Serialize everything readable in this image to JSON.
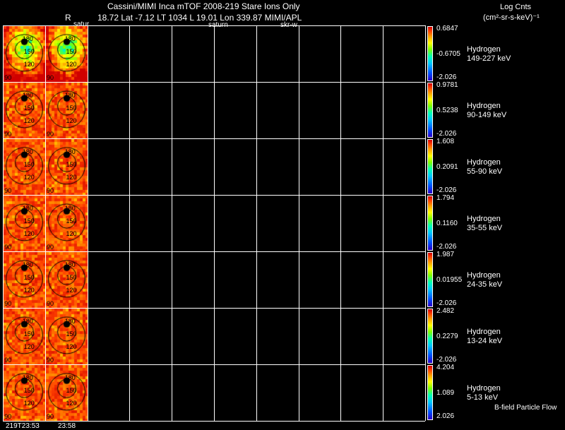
{
  "header": {
    "line1": "Cassini/MIMI Inca mTOF  2008-219   Stare    Ions Only",
    "r_label": "R",
    "saturn_left": "satur",
    "line2": "18.72 Lat -7.12 LT 1034 L       19.01 Lon        339.87  MIMI/APL",
    "saturn_mid": "saturn",
    "skr": "skr-w",
    "units_line1": "Log Cnts",
    "units_line2": "(cm²-sr-s-keV)⁻¹"
  },
  "axis_ticks": [
    "180",
    "150",
    "120",
    "90"
  ],
  "time_labels": [
    "219T23:53",
    "23:58"
  ],
  "footer_note": "B-field Particle Flow",
  "colorbar_colors": [
    "#2a00c8",
    "#0050ff",
    "#00c8ff",
    "#00ffb4",
    "#7cff00",
    "#ffff00",
    "#ffa000",
    "#ff4000",
    "#d00000"
  ],
  "channels": [
    {
      "species": "Hydrogen",
      "range": "149-227 keV",
      "max": "0.6847",
      "mid": "-0.6705",
      "min": "-2.026"
    },
    {
      "species": "Hydrogen",
      "range": "90-149 keV",
      "max": "0.9781",
      "mid": "0.5238",
      "min": "-2.026"
    },
    {
      "species": "Hydrogen",
      "range": "55-90 keV",
      "max": "1.608",
      "mid": "0.2091",
      "min": "-2.026"
    },
    {
      "species": "Hydrogen",
      "range": "35-55 keV",
      "max": "1.794",
      "mid": "0.1160",
      "min": "-2.026"
    },
    {
      "species": "Hydrogen",
      "range": "24-35 keV",
      "max": "1.987",
      "mid": "0.01955",
      "min": "-2.026"
    },
    {
      "species": "Hydrogen",
      "range": "13-24 keV",
      "max": "2.482",
      "mid": "0.2279",
      "min": "-2.026"
    },
    {
      "species": "Hydrogen",
      "range": "5-13 keV",
      "max": "4.204",
      "mid": "1.089",
      "min": "2.026"
    }
  ]
}
